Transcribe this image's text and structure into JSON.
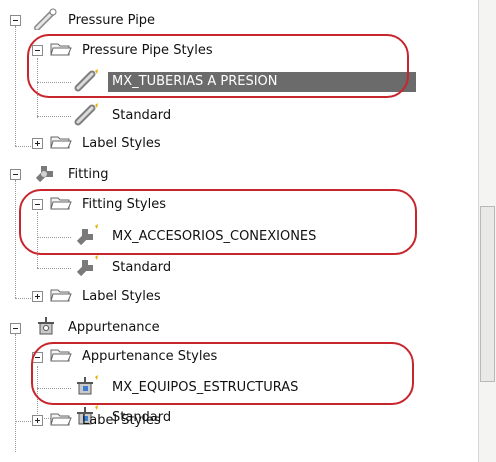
{
  "tree": {
    "groups": [
      {
        "name": "Pressure Pipe",
        "icon": "pressure-pipe-icon",
        "styles_folder": "Pressure Pipe Styles",
        "styles": [
          "MX_TUBERIAS A PRESION",
          "Standard"
        ],
        "label_styles": "Label Styles"
      },
      {
        "name": "Fitting",
        "icon": "fitting-icon",
        "styles_folder": "Fitting Styles",
        "styles": [
          "MX_ACCESORIOS_CONEXIONES",
          "Standard"
        ],
        "label_styles": "Label Styles"
      },
      {
        "name": "Appurtenance",
        "icon": "appurtenance-icon",
        "styles_folder": "Appurtenance Styles",
        "styles": [
          "MX_EQUIPOS_ESTRUCTURAS",
          "Standard"
        ],
        "label_styles": "Label Styles"
      }
    ],
    "selected": "MX_TUBERIAS A PRESION"
  },
  "colors": {
    "highlight": "#c8262d",
    "selection": "#6b6b6b",
    "folder": "#f3f3f3"
  }
}
